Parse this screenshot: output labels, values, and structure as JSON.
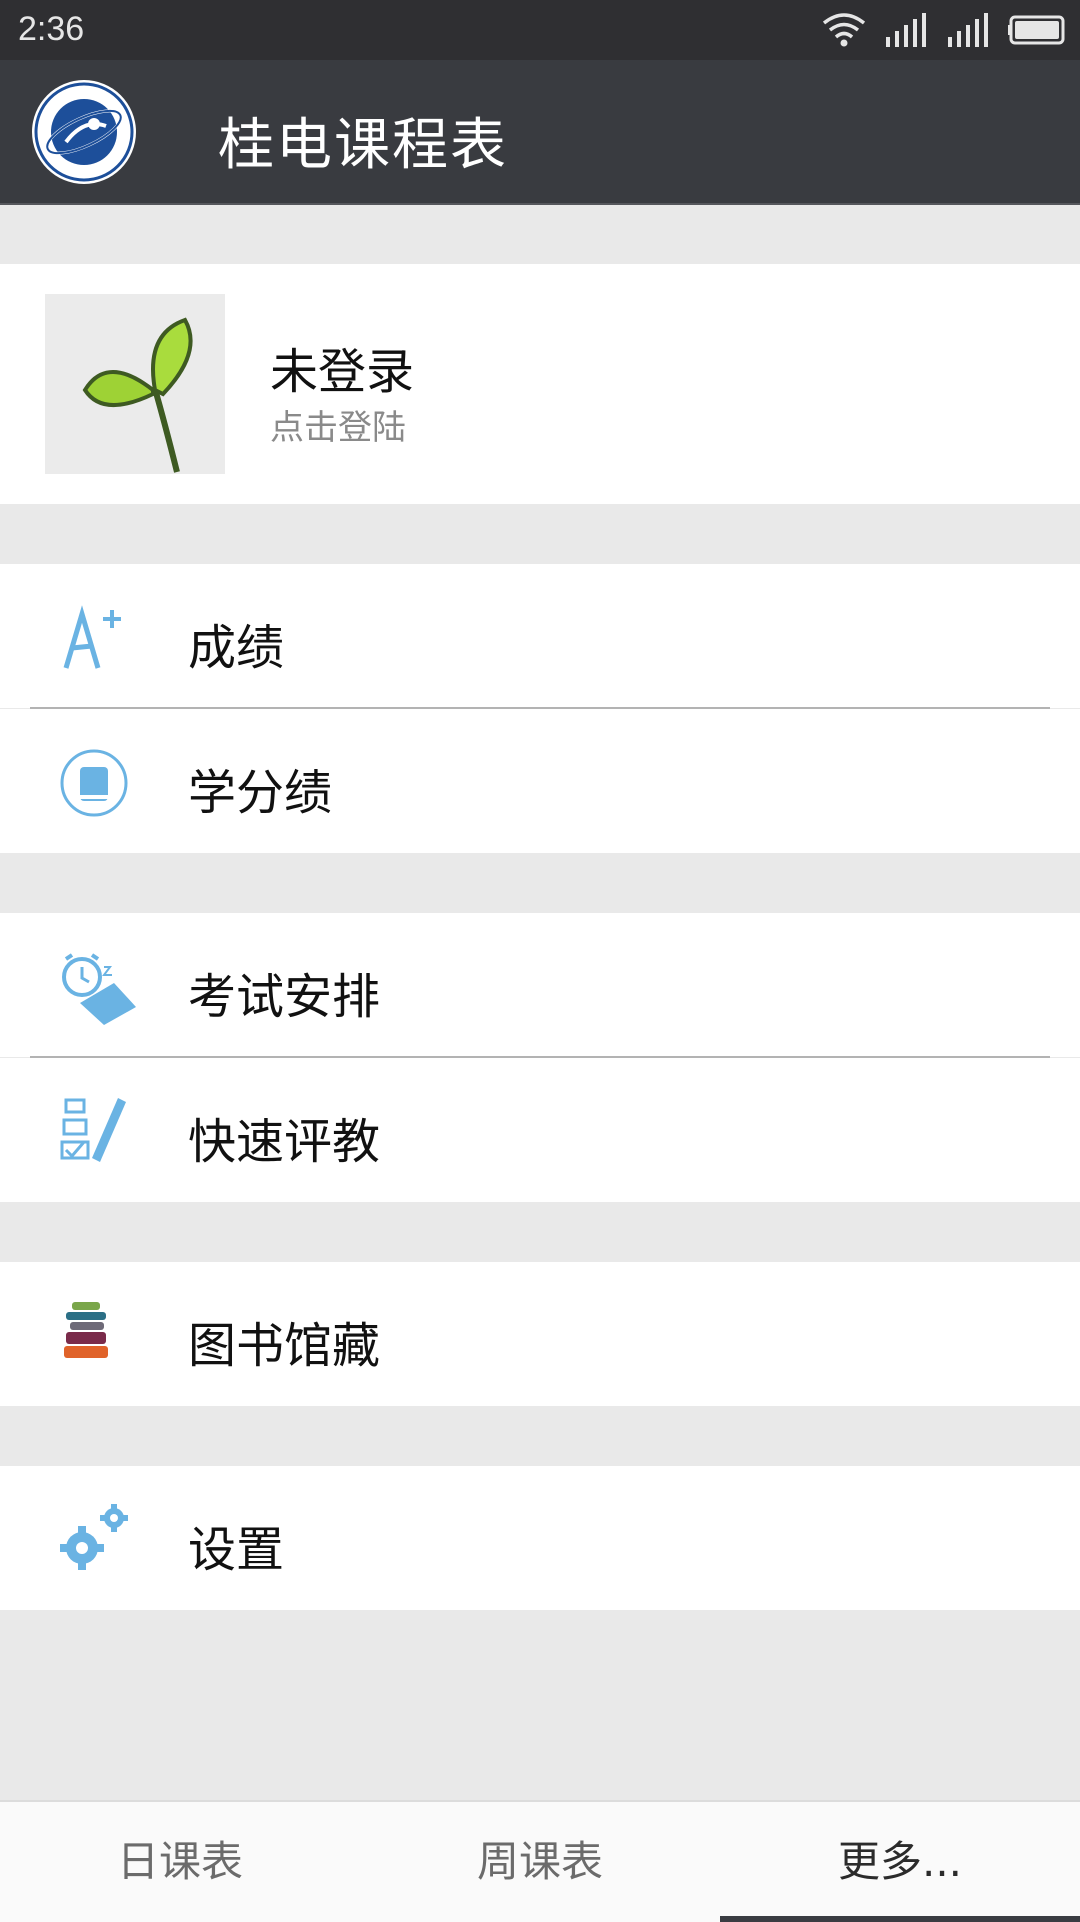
{
  "status_bar": {
    "time": "2:36"
  },
  "app_bar": {
    "title": "桂电课程表"
  },
  "profile": {
    "name": "未登录",
    "subtitle": "点击登陆"
  },
  "menu": {
    "grades": "成绩",
    "credit_gpa": "学分绩",
    "exam_schedule": "考试安排",
    "quick_evaluation": "快速评教",
    "library": "图书馆藏",
    "settings": "设置"
  },
  "bottom_nav": {
    "tabs": [
      "日课表",
      "周课表",
      "更多..."
    ],
    "active_index": 2
  },
  "colors": {
    "app_bar": "#393b40",
    "status_bar": "#2f2f32",
    "accent_blue": "#6ab3e3",
    "background": "#e9e9e9"
  },
  "icons": {
    "status": [
      "wifi-icon",
      "signal-icon",
      "signal-icon",
      "battery-icon"
    ],
    "menu": [
      "grade-a-plus-icon",
      "book-circle-icon",
      "alarm-clock-icon",
      "checklist-pen-icon",
      "book-stack-icon",
      "gears-icon"
    ]
  }
}
